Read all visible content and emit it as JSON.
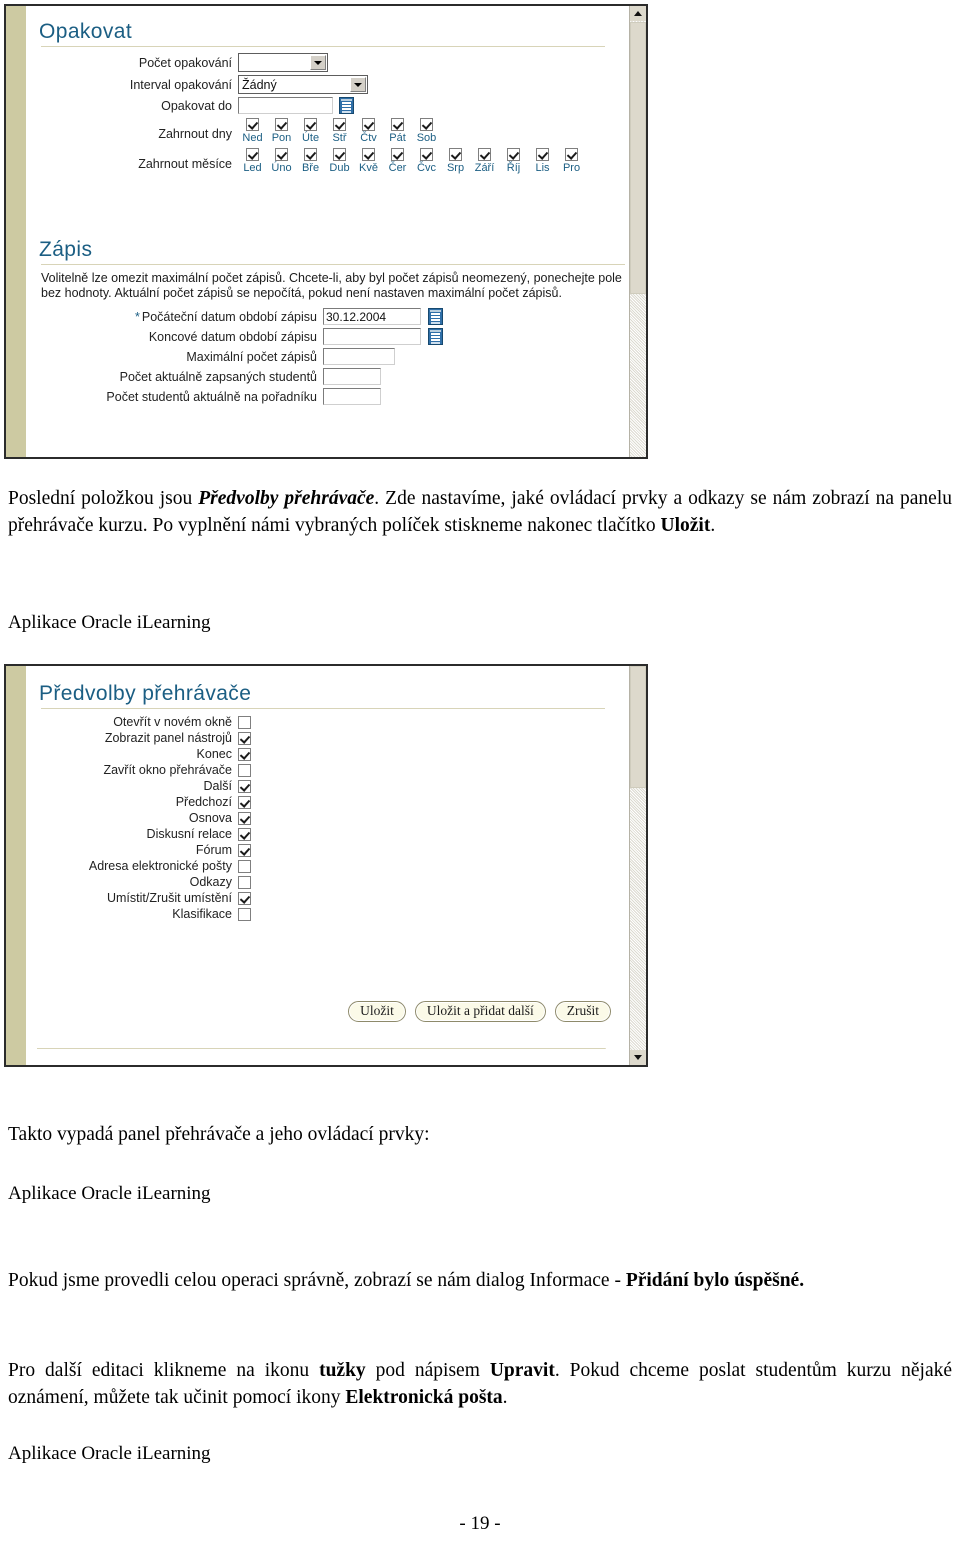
{
  "page": {
    "number_label": "- 19 -"
  },
  "screenshot_top": {
    "sections": [
      {
        "title": "Opakovat",
        "fields": [
          {
            "label": "Počet opakování",
            "type": "select",
            "value": ""
          },
          {
            "label": "Interval opakování",
            "type": "select",
            "value": "Žádný"
          },
          {
            "label": "Opakovat do",
            "type": "text-with-calendar",
            "value": ""
          }
        ],
        "day_group": {
          "label": "Zahrnout dny",
          "items": [
            {
              "label": "Ned",
              "checked": true
            },
            {
              "label": "Pon",
              "checked": true
            },
            {
              "label": "Úte",
              "checked": true
            },
            {
              "label": "Stř",
              "checked": true
            },
            {
              "label": "Čtv",
              "checked": true
            },
            {
              "label": "Pát",
              "checked": true
            },
            {
              "label": "Sob",
              "checked": true
            }
          ]
        },
        "month_group": {
          "label": "Zahrnout měsíce",
          "items": [
            {
              "label": "Led",
              "checked": true
            },
            {
              "label": "Úno",
              "checked": true
            },
            {
              "label": "Bře",
              "checked": true
            },
            {
              "label": "Dub",
              "checked": true
            },
            {
              "label": "Kvě",
              "checked": true
            },
            {
              "label": "Čer",
              "checked": true
            },
            {
              "label": "Čvc",
              "checked": true
            },
            {
              "label": "Srp",
              "checked": true
            },
            {
              "label": "Září",
              "checked": true
            },
            {
              "label": "Říj",
              "checked": true
            },
            {
              "label": "Lis",
              "checked": true
            },
            {
              "label": "Pro",
              "checked": true
            }
          ]
        }
      },
      {
        "title": "Zápis",
        "description": "Volitelně lze omezit maximální počet zápisů. Chcete-li, aby byl počet zápisů neomezený, ponechejte pole bez hodnoty. Aktuální počet zápisů se nepočítá, pokud není nastaven maximální počet zápisů.",
        "fields": [
          {
            "label": "Počáteční datum období zápisu",
            "required": true,
            "type": "text-with-calendar",
            "value": "30.12.2004"
          },
          {
            "label": "Koncové datum období zápisu",
            "required": false,
            "type": "text-with-calendar",
            "value": ""
          },
          {
            "label": "Maximální počet zápisů",
            "required": false,
            "type": "text",
            "value": ""
          },
          {
            "label": "Počet aktuálně zapsaných studentů",
            "required": false,
            "type": "text",
            "value": ""
          },
          {
            "label": "Počet studentů aktuálně na pořadníku",
            "required": false,
            "type": "text",
            "value": ""
          }
        ]
      }
    ]
  },
  "screenshot_bottom": {
    "title": "Předvolby přehrávače",
    "options": [
      {
        "label": "Otevřít v novém okně",
        "checked": false
      },
      {
        "label": "Zobrazit panel nástrojů",
        "checked": true
      },
      {
        "label": "Konec",
        "checked": true
      },
      {
        "label": "Zavřít okno přehrávače",
        "checked": false
      },
      {
        "label": "Další",
        "checked": true
      },
      {
        "label": "Předchozí",
        "checked": true
      },
      {
        "label": "Osnova",
        "checked": true
      },
      {
        "label": "Diskusní relace",
        "checked": true
      },
      {
        "label": "Fórum",
        "checked": true
      },
      {
        "label": "Adresa elektronické pošty",
        "checked": false
      },
      {
        "label": "Odkazy",
        "checked": false
      },
      {
        "label": "Umístit/Zrušit umístění",
        "checked": true
      },
      {
        "label": "Klasifikace",
        "checked": false
      }
    ],
    "buttons": [
      {
        "label": "Uložit"
      },
      {
        "label": "Uložit a přidat další"
      },
      {
        "label": "Zrušit"
      }
    ]
  },
  "prose": {
    "para1_a": "Poslední položkou jsou ",
    "para1_em": "Předvolby přehrávače",
    "para1_b": ". Zde nastavíme, jaké ovládací prvky a odkazy se nám zobrazí na panelu přehrávače kurzu. Po vyplnění námi vybraných políček stiskneme nakonec tlačítko ",
    "para1_strong": "Uložit",
    "para1_c": ".",
    "caption1": "Aplikace Oracle iLearning",
    "para2": "Takto vypadá panel přehrávače a jeho ovládací prvky:",
    "caption2": "Aplikace Oracle iLearning",
    "para3_a": "Pokud jsme provedli celou operaci správně, zobrazí se nám dialog Informace - ",
    "para3_strong": "Přidání bylo úspěšné.",
    "para4_a": "Pro další editaci klikneme na ikonu ",
    "para4_strong1": "tužky",
    "para4_b": " pod nápisem ",
    "para4_strong2": "Upravit",
    "para4_c": ". Pokud chceme poslat studentům kurzu nějaké oznámení, můžete tak učinit pomocí ikony ",
    "para4_strong3": "Elektronická pošta",
    "para4_d": ".",
    "caption3": "Aplikace Oracle iLearning"
  },
  "colors": {
    "heading_blue": "#1b5e83",
    "left_strip_khaki": "#cdcaa2",
    "rule_khaki": "#d8d4b8",
    "button_cream": "#fbfae8"
  }
}
